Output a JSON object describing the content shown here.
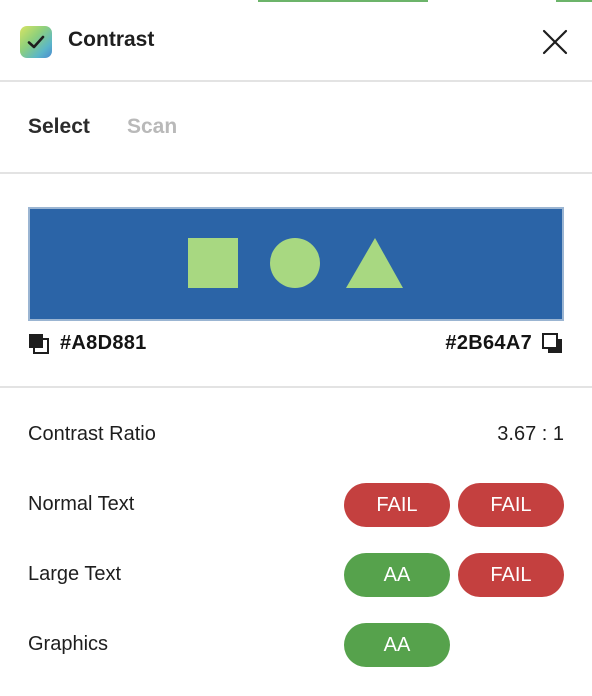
{
  "header": {
    "title": "Contrast"
  },
  "tabs": [
    {
      "label": "Select",
      "active": true
    },
    {
      "label": "Scan",
      "active": false
    }
  ],
  "colors": {
    "foreground": "#A8D881",
    "background": "#2B64A7",
    "fail": "#c4403f",
    "pass": "#56a24c"
  },
  "swatches": {
    "foreground_hex": "#A8D881",
    "background_hex": "#2B64A7"
  },
  "results": {
    "ratio_label": "Contrast Ratio",
    "ratio_value": "3.67 : 1",
    "rows": [
      {
        "label": "Normal Text",
        "badges": [
          "FAIL",
          "FAIL"
        ]
      },
      {
        "label": "Large Text",
        "badges": [
          "AA",
          "FAIL"
        ]
      },
      {
        "label": "Graphics",
        "badges": [
          "AA"
        ]
      }
    ]
  }
}
